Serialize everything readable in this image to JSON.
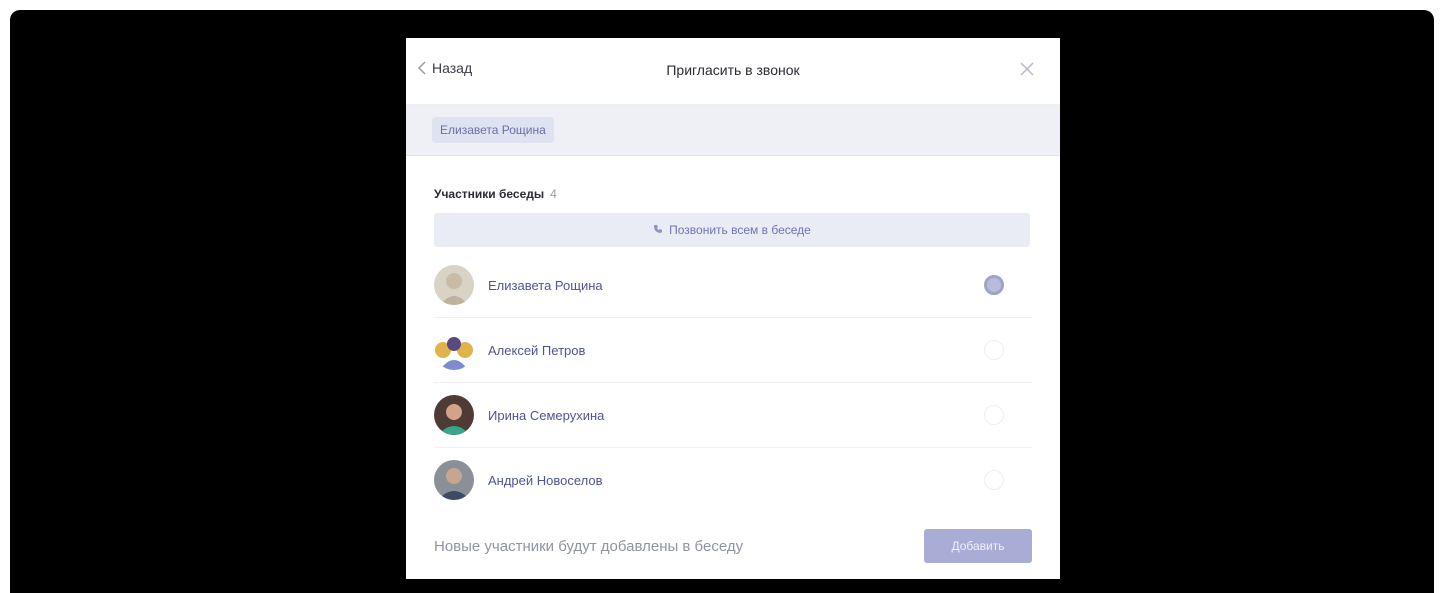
{
  "modal": {
    "back_label": "Назад",
    "title": "Пригласить в звонок"
  },
  "selected_chips": [
    "Елизавета Рощина"
  ],
  "section": {
    "title": "Участники беседы",
    "count": "4"
  },
  "call_all_label": "Позвонить всем в беседе",
  "members": [
    {
      "name": "Елизавета Рощина",
      "selected": true
    },
    {
      "name": "Алексей Петров",
      "selected": false
    },
    {
      "name": "Ирина Семерухина",
      "selected": false
    },
    {
      "name": "Андрей Новоселов",
      "selected": false
    }
  ],
  "footer": {
    "note": "Новые участники будут добавлены в беседу",
    "add_label": "Добавить"
  },
  "colors": {
    "accent": "#4f5398",
    "button_disabled": "#a9add6",
    "backdrop": "#000000"
  },
  "icons": {
    "back": "chevron-left-icon",
    "close": "close-icon",
    "phone": "phone-icon"
  }
}
